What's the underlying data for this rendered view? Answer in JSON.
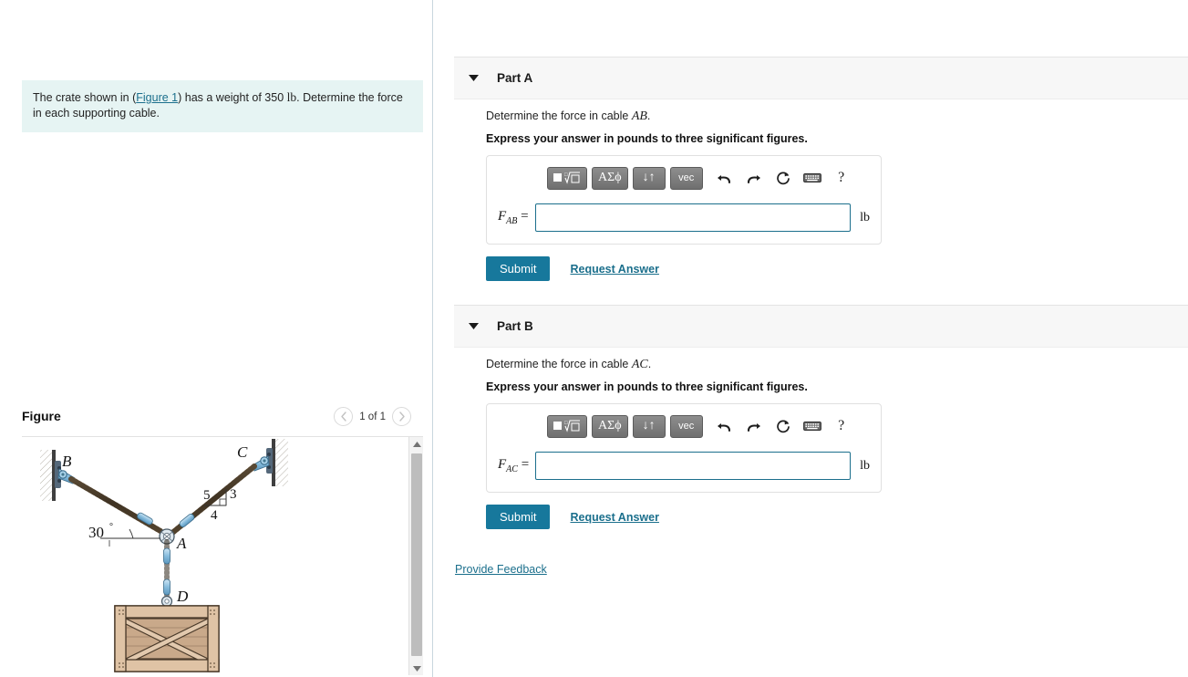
{
  "problem": {
    "text_before_link": "The crate shown in (",
    "figure_link": "Figure 1",
    "text_after_link": ") has a weight of 350 ",
    "weight_unit": "lb",
    "text_tail": ". Determine the force in each supporting cable."
  },
  "figure": {
    "title": "Figure",
    "counter": "1 of 1",
    "prev_icon": "chevron-left-icon",
    "next_icon": "chevron-right-icon",
    "scroll_up_icon": "triangle-up-icon",
    "scroll_down_icon": "triangle-down-icon",
    "diagram": {
      "labels": {
        "point_b": "B",
        "point_c": "C",
        "point_a": "A",
        "point_d": "D",
        "angle": "30",
        "angle_unit": "°",
        "triangle_hyp": "5",
        "triangle_vert": "3",
        "triangle_horiz": "4"
      },
      "colors": {
        "cable": "#6b5640",
        "fitting": "#8fc2de",
        "crate_wood": "#d8bda2",
        "crate_outline": "#4a3a2a",
        "wall": "#cfc9bd"
      }
    }
  },
  "parts": [
    {
      "id": "part-a",
      "label": "Part A",
      "caret_icon": "caret-down-icon",
      "prompt_prefix": "Determine the force in cable ",
      "prompt_var": "AB",
      "prompt_suffix": ".",
      "significance": "Express your answer in pounds to three significant figures.",
      "answer_symbol": "F",
      "answer_subscript": "AB",
      "answer_equals": "=",
      "answer_value": "",
      "answer_placeholder": "",
      "unit": "lb",
      "submit_label": "Submit",
      "request_label": "Request Answer"
    },
    {
      "id": "part-b",
      "label": "Part B",
      "caret_icon": "caret-down-icon",
      "prompt_prefix": "Determine the force in cable ",
      "prompt_var": "AC",
      "prompt_suffix": ".",
      "significance": "Express your answer in pounds to three significant figures.",
      "answer_symbol": "F",
      "answer_subscript": "AC",
      "answer_equals": "=",
      "answer_value": "",
      "answer_placeholder": "",
      "unit": "lb",
      "submit_label": "Submit",
      "request_label": "Request Answer"
    }
  ],
  "toolbar": {
    "buttons": [
      {
        "name": "template-radical-button",
        "label": "■√□",
        "icon": "radical-template-icon"
      },
      {
        "name": "greek-letters-button",
        "label": "ΑΣϕ",
        "icon": "greek-letters-icon"
      },
      {
        "name": "arrows-button",
        "label": "↓↑",
        "icon": "up-down-arrows-icon"
      },
      {
        "name": "vector-button",
        "label": "vec",
        "icon": "vector-icon"
      }
    ],
    "icons": [
      {
        "name": "undo-icon",
        "glyph": "undo"
      },
      {
        "name": "redo-icon",
        "glyph": "redo"
      },
      {
        "name": "reset-icon",
        "glyph": "reset"
      },
      {
        "name": "keyboard-icon",
        "glyph": "keyboard"
      },
      {
        "name": "help-icon",
        "glyph": "?"
      }
    ]
  },
  "footer": {
    "feedback_label": "Provide Feedback"
  },
  "colors": {
    "accent": "#17789c",
    "link": "#1b6f8c",
    "statement_bg": "#e6f4f3",
    "part_header_bg": "#f7f7f7",
    "divider": "#c9d6de"
  }
}
